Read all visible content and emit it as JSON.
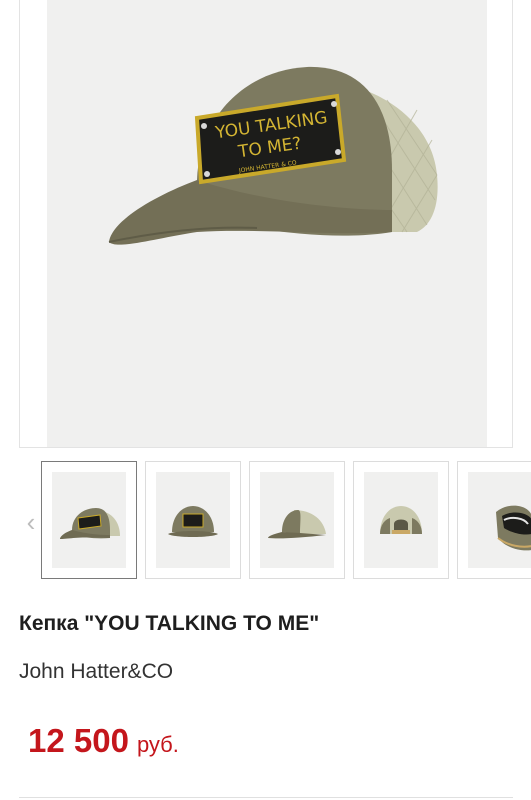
{
  "product": {
    "title": "Кепка \"YOU TALKING TO ME\"",
    "brand": "John Hatter&CO",
    "price": "12 500",
    "currency": "руб.",
    "patch_line1": "YOU TALKING",
    "patch_line2": "TO ME?",
    "patch_line3": "JOHN HATTER & CO"
  },
  "gallery": {
    "prev_icon": "chevron-left-icon",
    "thumbnails": [
      {
        "view": "front-left"
      },
      {
        "view": "front"
      },
      {
        "view": "side"
      },
      {
        "view": "back"
      },
      {
        "view": "underside"
      }
    ]
  },
  "colors": {
    "price": "#c4161c",
    "cap_olive": "#7d7a60",
    "mesh": "#c9c9ae",
    "patch_gold": "#c9a92a"
  }
}
